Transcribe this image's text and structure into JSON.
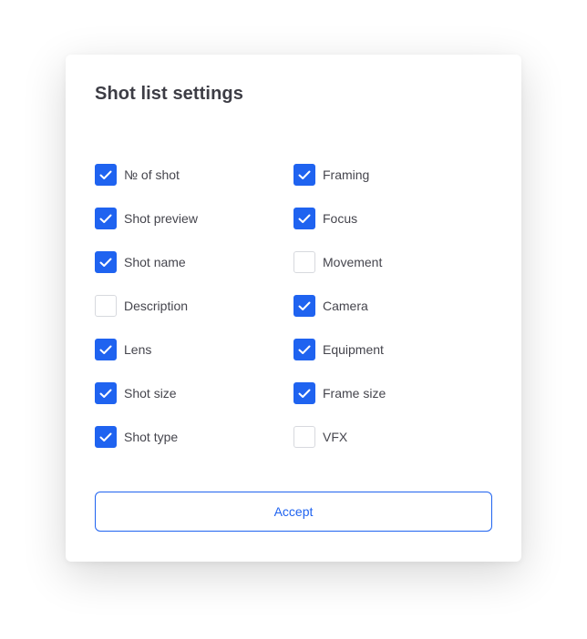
{
  "dialog": {
    "title": "Shot list settings",
    "accept_label": "Accept"
  },
  "options": {
    "left": [
      {
        "label": "№ of shot",
        "checked": true
      },
      {
        "label": "Shot preview",
        "checked": true
      },
      {
        "label": "Shot name",
        "checked": true
      },
      {
        "label": "Description",
        "checked": false
      },
      {
        "label": "Lens",
        "checked": true
      },
      {
        "label": "Shot size",
        "checked": true
      },
      {
        "label": "Shot type",
        "checked": true
      }
    ],
    "right": [
      {
        "label": "Framing",
        "checked": true
      },
      {
        "label": "Focus",
        "checked": true
      },
      {
        "label": "Movement",
        "checked": false
      },
      {
        "label": "Camera",
        "checked": true
      },
      {
        "label": "Equipment",
        "checked": true
      },
      {
        "label": "Frame size",
        "checked": true
      },
      {
        "label": "VFX",
        "checked": false
      }
    ]
  },
  "colors": {
    "accent": "#1f63f0",
    "title_text": "#3d3d45",
    "label_text": "#45454d",
    "unchecked_border": "#d7d9de"
  }
}
